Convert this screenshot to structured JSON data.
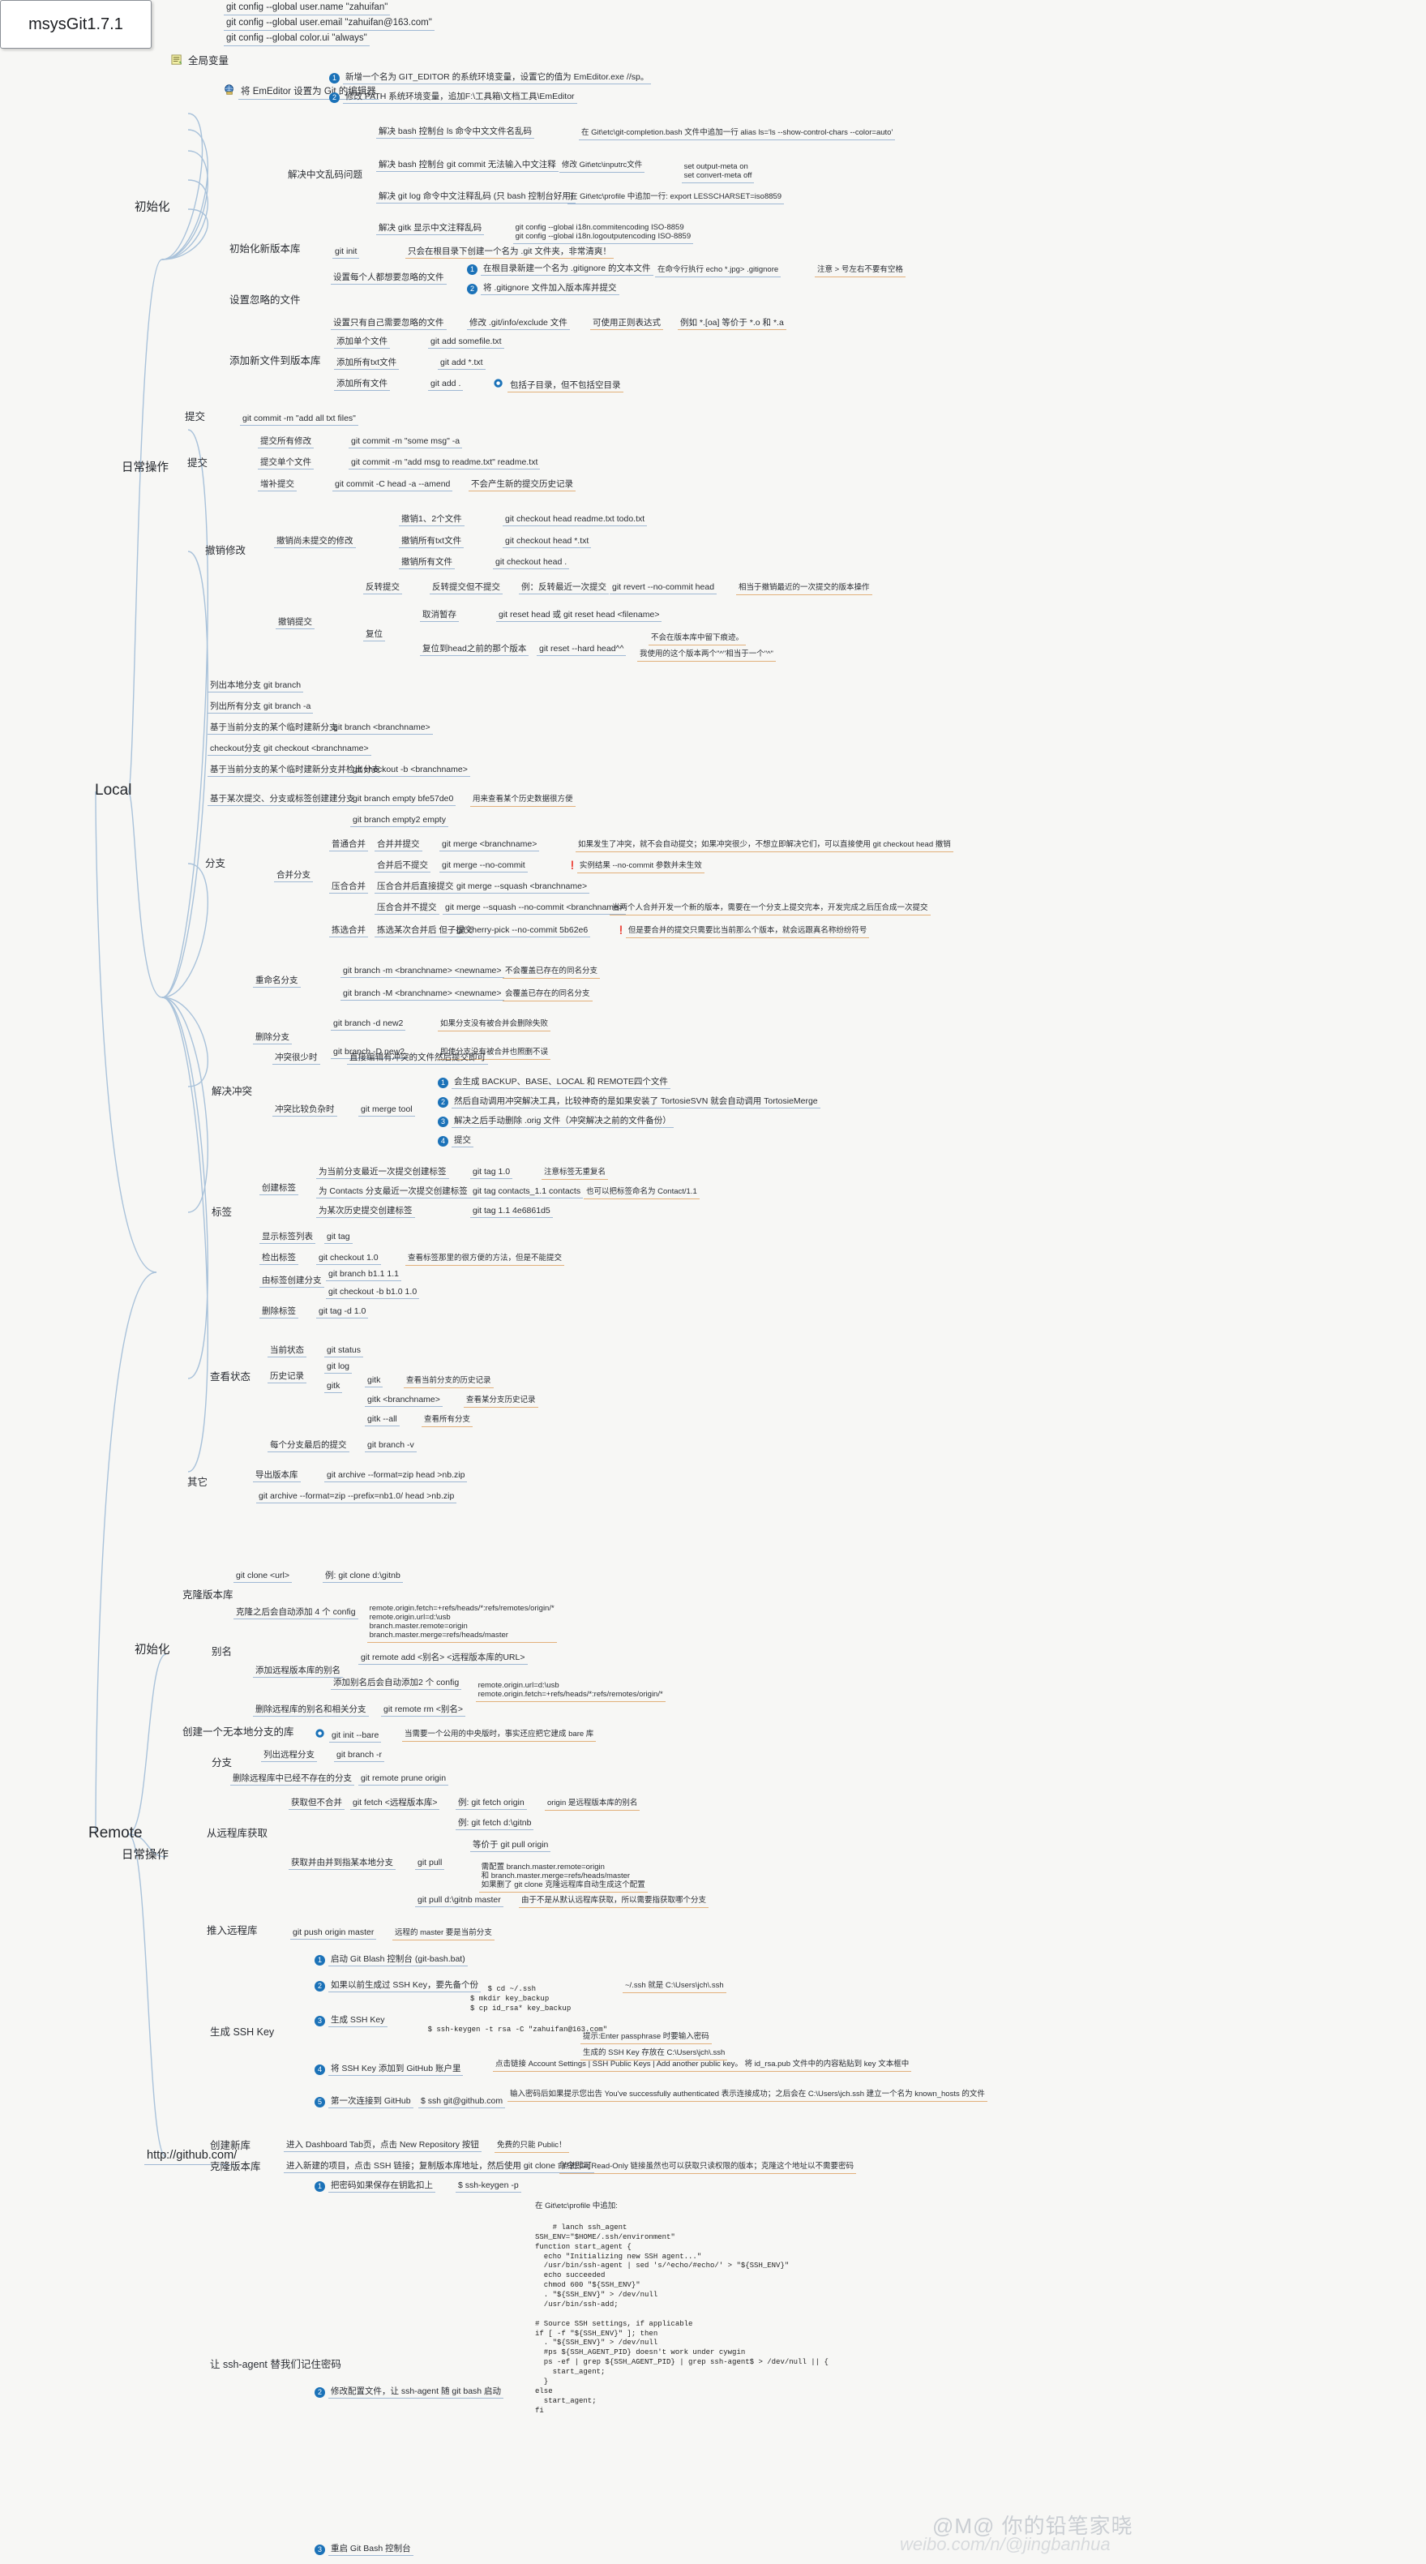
{
  "title": "msysGit1.7.1",
  "colors": {
    "branch_line": "#a9c2da",
    "underline_blue": "#9fb8d4",
    "underline_orange": "#e2b07a",
    "badge_blue": "#1b72b8",
    "background": "#f7f7f5",
    "root_border": "#8a8f96"
  },
  "root": {
    "label": "msysGit1.7.1"
  },
  "branches": [
    {
      "id": "local",
      "label": "Local"
    },
    {
      "id": "remote",
      "label": "Remote"
    }
  ],
  "local": {
    "init": {
      "label": "初始化"
    },
    "daily": {
      "label": "日常操作"
    },
    "global_vars": {
      "label": "全局变量",
      "icon": "note-icon",
      "items": [
        {
          "label": "git config --global user.name \"zahuifan\""
        },
        {
          "label": "git config --global user.email \"zahuifan@163.com\""
        },
        {
          "label": "git config --global color.ui \"always\""
        }
      ],
      "emeditor": {
        "label": "将 EmEditor 设置为 Git 的编辑器",
        "icon": "globe-icon",
        "steps": [
          {
            "n": "1",
            "label": "新增一个名为 GIT_EDITOR 的系统环境变量，设置它的值为 EmEditor.exe //sp。"
          },
          {
            "n": "2",
            "label": "修改 PATH 系统环境变量，追加F:\\工具箱\\文档工具\\EmEditor"
          }
        ]
      },
      "encoding": {
        "label": "解决中文乱码问题",
        "items": [
          {
            "label": "解决 bash 控制台 ls  命令中文文件名乱码",
            "detail": "在 Git\\etc\\git-completion.bash 文件中追加一行 alias ls='ls --show-control-chars --color=auto'"
          },
          {
            "label": "解决 bash 控制台 git commit 无法输入中文注释",
            "detail": "修改  Git\\etc\\inputrc文件",
            "detail2": "set output-meta on\nset convert-meta off"
          },
          {
            "label": "解决 git log 命令中文注释乱码 (只 bash 控制台好用)",
            "detail": "在 Git\\etc\\profile 中追加一行: export LESSCHARSET=iso8859"
          },
          {
            "label": "解决 gitk 显示中文注释乱码",
            "detail": "git config --global i18n.commitencoding ISO-8859\ngit config --global i18n.logoutputencoding ISO-8859"
          }
        ]
      }
    },
    "init_repo": {
      "label": "初始化新版本库",
      "cmd": "git init",
      "note": "只会在根目录下创建一个名为 .git 文件夹，非常清爽！"
    },
    "ignore": {
      "label": "设置忽略的文件",
      "everyone": {
        "label": "设置每个人都想要忽略的文件",
        "steps": [
          {
            "n": "1",
            "label": "在根目录新建一个名为 .gitignore 的文本文件",
            "detail": "在命令行执行 echo *.jpg> .gitignore",
            "note": "注意 > 号左右不要有空格"
          },
          {
            "n": "2",
            "label": "将 .gitignore 文件加入版本库并提交"
          }
        ]
      },
      "self": {
        "label": "设置只有自己需要忽略的文件",
        "detail": "修改 .git/info/exclude 文件",
        "note": "可使用正则表达式",
        "note2": "例如 *.[oa] 等价于 *.o 和 *.a"
      }
    },
    "add": {
      "label": "添加新文件到版本库",
      "items": [
        {
          "label": "添加单个文件",
          "cmd": "git add somefile.txt"
        },
        {
          "label": "添加所有txt文件",
          "cmd": "git add *.txt"
        },
        {
          "label": "添加所有文件",
          "cmd": "git add .",
          "note": "包括子目录，但不包括空目录",
          "icon": "target-icon"
        }
      ]
    },
    "commit_top": {
      "label": "提交",
      "cmd": "git commit -m \"add all txt files\""
    },
    "commit": {
      "label": "提交",
      "items": [
        {
          "label": "提交所有修改",
          "cmd": "git commit -m \"some msg\" -a"
        },
        {
          "label": "提交单个文件",
          "cmd": "git commit -m \"add msg to readme.txt\" readme.txt"
        },
        {
          "label": "增补提交",
          "cmd": "git commit -C head -a --amend",
          "note": "不会产生新的提交历史记录"
        }
      ]
    },
    "undo": {
      "label": "撤销修改",
      "uncommitted": {
        "label": "撤销尚未提交的修改",
        "items": [
          {
            "label": "撤销1、2个文件",
            "cmd": "git checkout head readme.txt todo.txt"
          },
          {
            "label": "撤销所有txt文件",
            "cmd": "git checkout head *.txt"
          },
          {
            "label": "撤销所有文件",
            "cmd": "git checkout head ."
          }
        ]
      },
      "committed": {
        "label": "撤销提交",
        "revert": {
          "label": "反转提交",
          "sub": "反转提交但不提交",
          "example": "例：反转最近一次提交",
          "cmd": "git revert --no-commit head",
          "note": "相当于撤销最近的一次提交的版本操作"
        },
        "reset": {
          "label": "复位",
          "items": [
            {
              "label": "取消暂存",
              "cmd": "git reset head 或 git reset head <filename>"
            },
            {
              "label": "复位到head之前的那个版本",
              "cmd": "git reset --hard head^^",
              "note1": "不会在版本库中留下痕迹。",
              "note2": "我使用的这个版本两个\"^\"相当于一个\"^\""
            }
          ]
        }
      }
    },
    "branch": {
      "label": "分支",
      "items": [
        {
          "label": "列出本地分支",
          "cmd": "git branch"
        },
        {
          "label": "列出所有分支",
          "cmd": "git branch -a"
        },
        {
          "label": "基于当前分支的某个临时建新分支",
          "cmd": "git branch <branchname>"
        },
        {
          "label": "checkout分支",
          "cmd": "git checkout <branchname>"
        },
        {
          "label": "基于当前分支的某个临时建新分支并检出分支",
          "cmd": "git checkout -b <branchname>"
        },
        {
          "label": "基于某次提交、分支或标签创建建分支",
          "cmd": "git branch empty bfe57de0",
          "note": "用来查看某个历史数据很方便"
        },
        {
          "label": "",
          "cmd": "git branch empty2 empty"
        }
      ],
      "merge": {
        "label": "合并分支",
        "items": [
          {
            "label": "普通合并",
            "sub": "合并并提交",
            "cmd": "git merge <branchname>",
            "note": "如果发生了冲突，就不会自动提交；如果冲突很少，不想立即解决它们，可以直接使用 git checkout head  撤销"
          },
          {
            "label": "",
            "sub": "合并后不提交",
            "cmd": "git merge --no-commit",
            "note": "实例结果 --no-commit 参数并未生效",
            "flag": true
          },
          {
            "label": "压合合并",
            "sub": "压合合并后直接提交",
            "cmd": "git merge --squash <branchname>"
          },
          {
            "label": "",
            "sub": "压合合并不提交",
            "cmd": "git merge --squash --no-commit <branchname>",
            "note": "当两个人合并开发一个新的版本，需要在一个分支上提交完本，开发完成之后压合成一次提交"
          },
          {
            "label": "拣选合并",
            "sub": "拣选某次合并后 但子提交",
            "cmd": "git cherry-pick --no-commit 5b62e6",
            "note": "但是要合并的提交只需要比当前那么个版本，就会远跟真名称纷纷符号",
            "flag": true
          }
        ]
      },
      "rename": {
        "label": "重命名分支",
        "items": [
          {
            "cmd": "git branch -m <branchname> <newname>",
            "note": "不会覆盖已存在的同名分支"
          },
          {
            "cmd": "git branch -M <branchname> <newname>",
            "note": "会覆盖已存在的同名分支"
          }
        ]
      },
      "delete": {
        "label": "删除分支",
        "items": [
          {
            "cmd": "git branch -d new2",
            "note": "如果分支没有被合并会删除失败"
          },
          {
            "cmd": "git branch -D new2",
            "note": "即使分支没有被合并也照删不误"
          }
        ]
      }
    },
    "conflict": {
      "label": "解决冲突",
      "few": {
        "label": "冲突很少时",
        "detail": "直接编辑有冲突的文件然后提交即可"
      },
      "many": {
        "label": "冲突比较负杂时",
        "cmd": "git merge tool",
        "steps": [
          {
            "n": "1",
            "label": "会生成 BACKUP、BASE、LOCAL 和 REMOTE四个文件"
          },
          {
            "n": "2",
            "label": "然后自动调用冲突解决工具，比较神奇的是如果安装了 TortosieSVN 就会自动调用  TortosieMerge"
          },
          {
            "n": "3",
            "label": "解决之后手动删除 .orig 文件（冲突解决之前的文件备份）"
          },
          {
            "n": "4",
            "label": "提交"
          }
        ]
      }
    },
    "tag": {
      "label": "标签",
      "items": [
        {
          "label": "创建标签",
          "sub": "为当前分支最近一次提交创建标签",
          "cmd": "git tag 1.0",
          "note": "注意标签无重复名"
        },
        {
          "label": "",
          "sub": "为 Contacts 分支最近一次提交创建标签",
          "cmd": "git tag contacts_1.1 contacts",
          "note": "也可以把标签命名为 Contact/1.1"
        },
        {
          "label": "",
          "sub": "为某次历史提交创建标签",
          "cmd": "git tag 1.1 4e6861d5"
        },
        {
          "label": "显示标签列表",
          "cmd": "git tag"
        },
        {
          "label": "检出标签",
          "cmd": "git checkout 1.0",
          "note": "查看标签那里的很方便的方法，但是不能提交"
        },
        {
          "label": "由标签创建分支",
          "sub": "git branch b1.1 1.1",
          "cmd": "git checkout -b b1.0 1.0"
        },
        {
          "label": "删除标签",
          "cmd": "git tag -d 1.0"
        }
      ]
    },
    "status": {
      "label": "查看状态",
      "items": [
        {
          "label": "当前状态",
          "cmd": "git status"
        },
        {
          "label": "历史记录",
          "cmd": "git log"
        },
        {
          "label": "",
          "cmd": "gitk",
          "items": [
            {
              "cmd": "gitk",
              "note": "查看当前分支的历史记录"
            },
            {
              "cmd": "gitk <branchname>",
              "note": "查看某分支历史记录"
            },
            {
              "cmd": "gitk --all",
              "note": "查看所有分支"
            }
          ]
        },
        {
          "label": "每个分支最后的提交",
          "cmd": "git branch -v"
        }
      ]
    },
    "other": {
      "label": "其它",
      "items": [
        {
          "label": "导出版本库",
          "cmd": "git archive --format=zip head >nb.zip"
        },
        {
          "label": "",
          "cmd": "git archive --format=zip --prefix=nb1.0/ head >nb.zip"
        }
      ]
    }
  },
  "remote": {
    "init": {
      "label": "初始化"
    },
    "daily": {
      "label": "日常操作"
    },
    "site": {
      "label": "http://github.com/"
    },
    "clone": {
      "label": "克隆版本库",
      "cmd": "git clone <url>",
      "example": "例: git clone d:\\gitnb",
      "detail": "克隆之后会自动添加 4 个 config",
      "config": "remote.origin.fetch=+refs/heads/*:refs/remotes/origin/*\nremote.origin.url=d:\\usb\nbranch.master.remote=origin\nbranch.master.merge=refs/heads/master"
    },
    "alias": {
      "label": "别名",
      "add": {
        "label": "添加远程版本库的别名",
        "cmd": "git remote add <别名> <远程版本库的URL>",
        "detail": "添加别名后会自动添加2 个 config",
        "config": "remote.origin.url=d:\\usb\nremote.origin.fetch=+refs/heads/*:refs/remotes/origin/*"
      },
      "remove": {
        "label": "删除远程库的别名和相关分支",
        "cmd": "git remote rm <别名>"
      }
    },
    "bare": {
      "label": "创建一个无本地分支的库",
      "cmd": "git init --bare",
      "note": "当需要一个公用的中央版时，事实还应把它建成 bare 库"
    },
    "branch": {
      "label": "分支",
      "items": [
        {
          "label": "列出远程分支",
          "cmd": "git branch -r"
        },
        {
          "label": "删除远程库中已经不存在的分支",
          "cmd": "git remote prune origin"
        }
      ]
    },
    "fetch": {
      "label": "从远程库获取",
      "items": [
        {
          "label": "获取但不合并",
          "cmd": "git fetch <远程版本库>",
          "example": "例: git fetch origin",
          "note": "origin 是远程版本库的别名"
        },
        {
          "label": "",
          "cmd": "",
          "example": "例: git fetch d:\\gitnb"
        },
        {
          "label": "获取并由并到指某本地分支",
          "cmd": "git pull",
          "note1": "等价于 git pull origin",
          "note2": "需配置 branch.master.remote=origin\n和 branch.master.merge=refs/heads/master\n如果删了 git clone 克隆远程库自动生成这个配置"
        },
        {
          "label": "",
          "cmd": "git pull d:\\gitnb master",
          "note": "由于不是从默认远程库获取，所以需要指获取哪个分支"
        }
      ]
    },
    "push": {
      "label": "推入远程库",
      "cmd": "git push origin master",
      "note": "远程的 master 要是当前分支"
    },
    "ssh": {
      "label": "生成 SSH Key",
      "steps": [
        {
          "n": "1",
          "label": "启动 Git  Blash 控制台 (git-bash.bat)"
        },
        {
          "n": "2",
          "label": "如果以前生成过 SSH Key，要先备个份",
          "code": "$ cd ~/.ssh\n$ mkdir key_backup\n$ cp id_rsa* key_backup",
          "note": "~/.ssh 就是 C:\\Users\\jch\\.ssh"
        },
        {
          "n": "3",
          "label": "生成 SSH Key",
          "code": "$ ssh-keygen -t rsa -C \"zahuifan@163.com\"",
          "note1": "提示:Enter passphrase 时要输入密码",
          "note2": "生成的 SSH Key 存放在 C:\\Users\\jch\\.ssh"
        },
        {
          "n": "4",
          "label": "将 SSH Key 添加到 GitHub 账户里",
          "note": "点击链接 Account Settings | SSH Public Keys | Add another public  key。 将 id_rsa.pub 文件中的内容粘贴到 key 文本框中"
        },
        {
          "n": "5",
          "label": "第一次连接到 GitHub",
          "cmd": "$ ssh git@github.com",
          "note": "输入密码后如果提示您出告 You've successfully authenticated 表示连接成功；之后会在 C:\\Users\\jch.ssh 建立一个名为 known_hosts 的文件"
        }
      ]
    },
    "newrepo": {
      "label": "创建新库",
      "detail": "进入 Dashboard Tab页，点击 New Repository 按钮",
      "note": "免费的只能 Public！"
    },
    "clone_repo": {
      "label": "克隆版本库",
      "detail": "进入新建的项目，点击 SSH 链接；复制版本库地址，然后使用 git clone 命令即可",
      "note": "点击 Git Read-Only 链接虽然也可以获取只读权限的版本；克隆这个地址以不需要密码"
    },
    "sshagent": {
      "label": "让 ssh-agent 替我们记住密码",
      "steps": [
        {
          "n": "1",
          "label": "把密码如果保存在钥匙扣上",
          "cmd": "$ ssh-keygen -p",
          "note": "在 Git\\etc\\profile 中追加:",
          "code": "# lanch ssh_agent\nSSH_ENV=\"$HOME/.ssh/environment\"\nfunction start_agent {\n  echo \"Initializing new SSH agent...\"\n  /usr/bin/ssh-agent | sed 's/^echo/#echo/' > \"${SSH_ENV}\"\n  echo succeeded\n  chmod 600 \"${SSH_ENV}\"\n  . \"${SSH_ENV}\" > /dev/null\n  /usr/bin/ssh-add;\n\n# Source SSH settings, if applicable\nif [ -f \"${SSH_ENV}\" ]; then\n  . \"${SSH_ENV}\" > /dev/null\n  #ps ${SSH_AGENT_PID} doesn't work under cywgin\n  ps -ef | grep ${SSH_AGENT_PID} | grep ssh-agent$ > /dev/null || {\n    start_agent;\n  }\nelse\n  start_agent;\nfi"
        },
        {
          "n": "2",
          "label": "修改配置文件，让 ssh-agent 随 git bash 启动"
        },
        {
          "n": "3",
          "label": "重启 Git Bash 控制台"
        }
      ]
    }
  },
  "watermark": {
    "line1": "weibo.com/n/@jingbanhua",
    "line2": "@M@ 你的铅笔家晓"
  }
}
